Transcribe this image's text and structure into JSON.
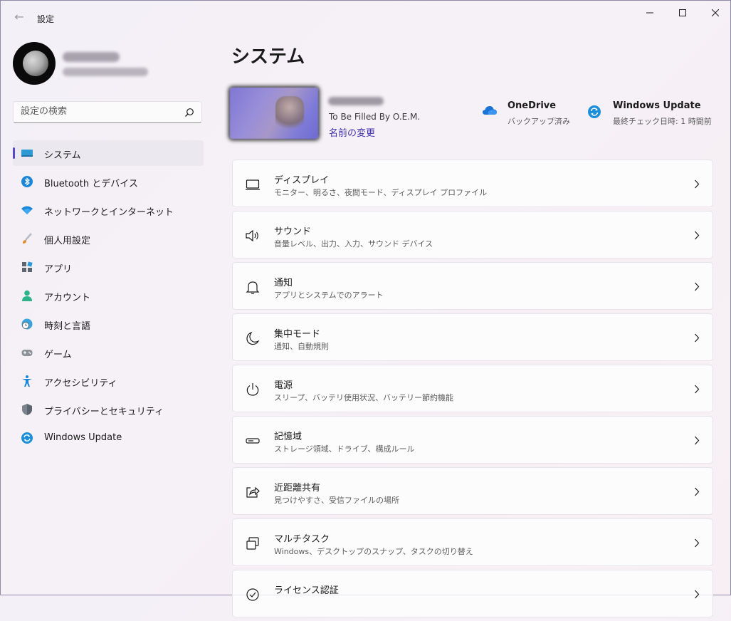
{
  "window": {
    "title": "設定",
    "back_glyph": "←",
    "controls": [
      "minimize-icon",
      "maximize-icon",
      "close-icon"
    ]
  },
  "search": {
    "placeholder": "設定の検索",
    "value": ""
  },
  "sidebar": {
    "items": [
      {
        "label": "システム",
        "icon": "monitor-icon",
        "active": true
      },
      {
        "label": "Bluetooth とデバイス",
        "icon": "bluetooth-icon"
      },
      {
        "label": "ネットワークとインターネット",
        "icon": "wifi-icon"
      },
      {
        "label": "個人用設定",
        "icon": "brush-icon"
      },
      {
        "label": "アプリ",
        "icon": "apps-icon"
      },
      {
        "label": "アカウント",
        "icon": "person-icon"
      },
      {
        "label": "時刻と言語",
        "icon": "globe-clock-icon"
      },
      {
        "label": "ゲーム",
        "icon": "gamepad-icon"
      },
      {
        "label": "アクセシビリティ",
        "icon": "accessibility-icon"
      },
      {
        "label": "プライバシーとセキュリティ",
        "icon": "shield-icon"
      },
      {
        "label": "Windows Update",
        "icon": "update-icon"
      }
    ]
  },
  "main": {
    "title": "システム",
    "device": {
      "model": "To Be Filled By O.E.M.",
      "rename_link": "名前の変更"
    },
    "onedrive": {
      "title": "OneDrive",
      "status": "バックアップ済み"
    },
    "windows_update": {
      "title": "Windows Update",
      "status": "最終チェック日時: 1 時間前"
    },
    "cards": [
      {
        "title": "ディスプレイ",
        "subtitle": "モニター、明るさ、夜間モード、ディスプレイ プロファイル",
        "icon": "display-icon"
      },
      {
        "title": "サウンド",
        "subtitle": "音量レベル、出力、入力、サウンド デバイス",
        "icon": "speaker-icon"
      },
      {
        "title": "通知",
        "subtitle": "アプリとシステムでのアラート",
        "icon": "bell-icon"
      },
      {
        "title": "集中モード",
        "subtitle": "通知、自動規則",
        "icon": "moon-icon"
      },
      {
        "title": "電源",
        "subtitle": "スリープ、バッテリ使用状況、バッテリー節約機能",
        "icon": "power-icon"
      },
      {
        "title": "記憶域",
        "subtitle": "ストレージ領域、ドライブ、構成ルール",
        "icon": "storage-icon"
      },
      {
        "title": "近距離共有",
        "subtitle": "見つけやすさ、受信ファイルの場所",
        "icon": "share-icon"
      },
      {
        "title": "マルチタスク",
        "subtitle": "Windows、デスクトップのスナップ、タスクの切り替え",
        "icon": "multitask-icon"
      },
      {
        "title": "ライセンス認証",
        "subtitle": "",
        "icon": "activation-icon"
      }
    ]
  },
  "colors": {
    "accent": "#5b47c9",
    "link": "#3f2fb0",
    "onedrive": "#1b73d3",
    "update": "#1d8fd8"
  }
}
